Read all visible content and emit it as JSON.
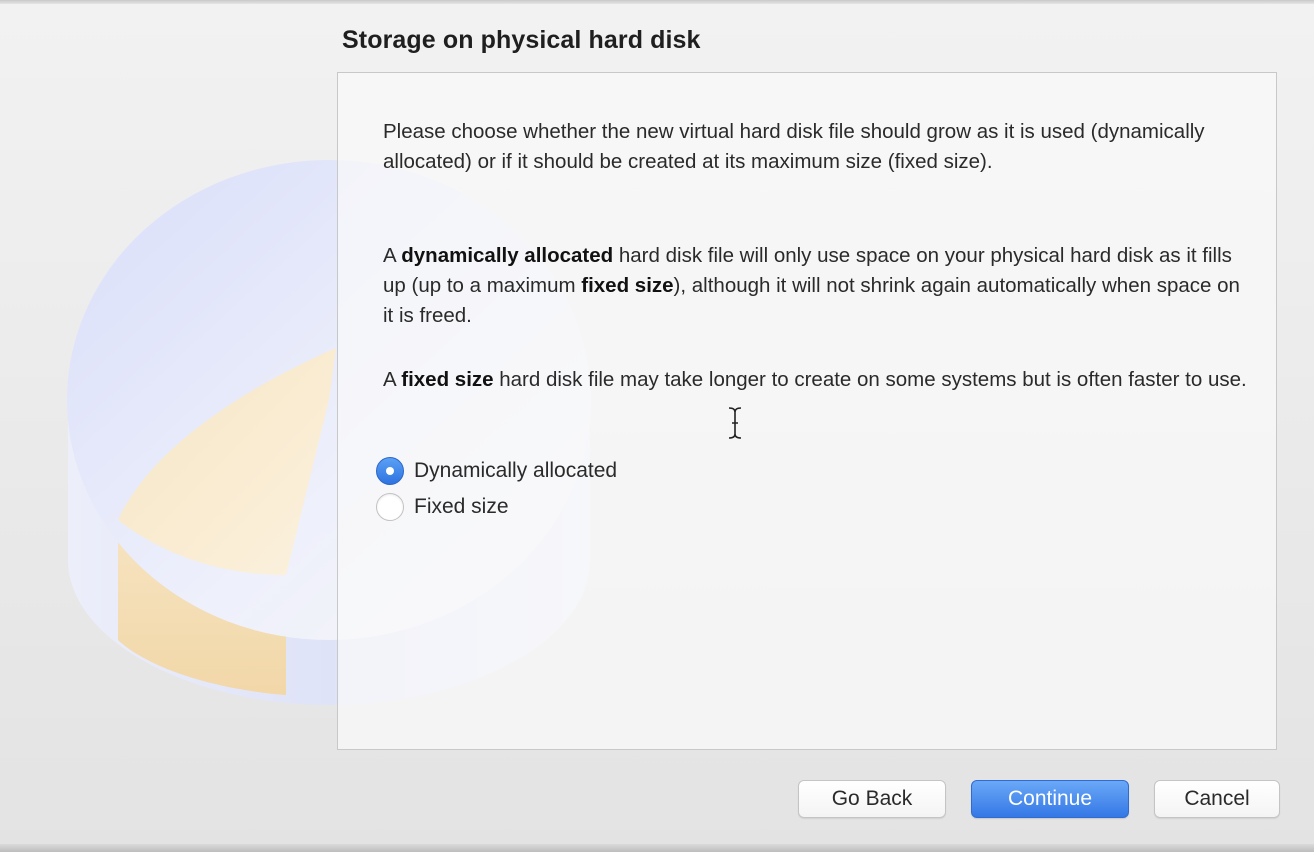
{
  "dialog": {
    "title": "Storage on physical hard disk",
    "paragraph1": "Please choose whether the new virtual hard disk file should grow as it is used (dynamically allocated) or if it should be created at its maximum size (fixed size).",
    "paragraph2": {
      "part1": "A ",
      "bold1": "dynamically allocated",
      "part2": " hard disk file will only use space on your physical hard disk as it fills up (up to a maximum ",
      "bold2": "fixed size",
      "part3": "), although it will not shrink again automatically when space on it is freed."
    },
    "paragraph3": {
      "part1": "A ",
      "bold1": "fixed size",
      "part2": " hard disk file may take longer to create on some systems but is often faster to use."
    },
    "options": [
      {
        "label": "Dynamically allocated",
        "selected": true
      },
      {
        "label": "Fixed size",
        "selected": false
      }
    ]
  },
  "buttons": {
    "back": "Go Back",
    "continue": "Continue",
    "cancel": "Cancel"
  },
  "colors": {
    "accent": "#3478e6",
    "disk_body": "#e4e8fb",
    "disk_slice": "#f3dcb0"
  },
  "icons": {
    "watermark": "hard-disk-pie-watermark",
    "cursor": "text-cursor-ibeam"
  }
}
